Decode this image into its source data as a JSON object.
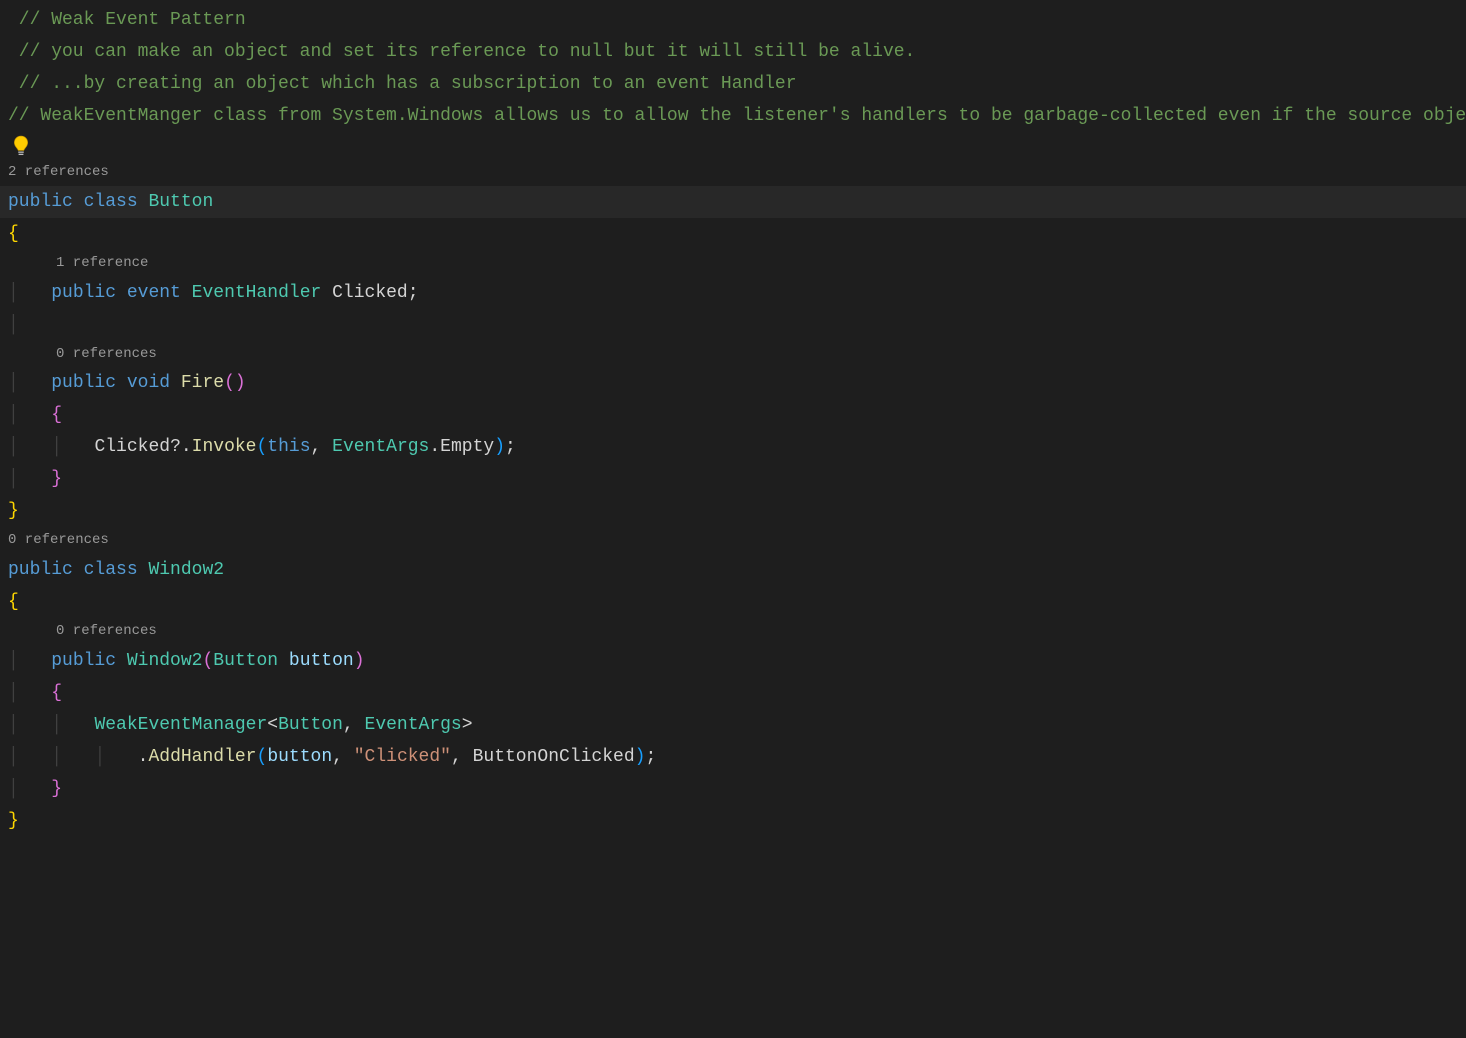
{
  "lines": {
    "c1": " // Weak Event Pattern",
    "c2": " // you can make an object and set its reference to null but it will still be alive.",
    "c3": " // ...by creating an object which has a subscription to an event Handler",
    "c4": "// WeakEventManger class from System.Windows allows us to allow the listener's handlers to be garbage-collected even if the source object persists"
  },
  "codelens": {
    "button_class": "2 references",
    "clicked_event": "1 reference",
    "fire_method": "0 references",
    "window2_class": "0 references",
    "window2_ctor": "0 references"
  },
  "tokens": {
    "public": "public",
    "class": "class",
    "event": "event",
    "void": "void",
    "this": "this",
    "Button": "Button",
    "Window2": "Window2",
    "EventHandler": "EventHandler",
    "EventArgs": "EventArgs",
    "WeakEventManager": "WeakEventManager",
    "Clicked": "Clicked",
    "Fire": "Fire",
    "Invoke": "Invoke",
    "Empty": "Empty",
    "AddHandler": "AddHandler",
    "button": "button",
    "ButtonOnClicked": "ButtonOnClicked",
    "ClickedStr": "\"Clicked\""
  },
  "punct": {
    "open_brace": "{",
    "close_brace": "}",
    "open_paren": "(",
    "close_paren": ")",
    "semicolon": ";",
    "comma": ",",
    "dot": ".",
    "qdot": "?.",
    "lt": "<",
    "gt": ">"
  },
  "icons": {
    "lightbulb": "lightbulb"
  }
}
